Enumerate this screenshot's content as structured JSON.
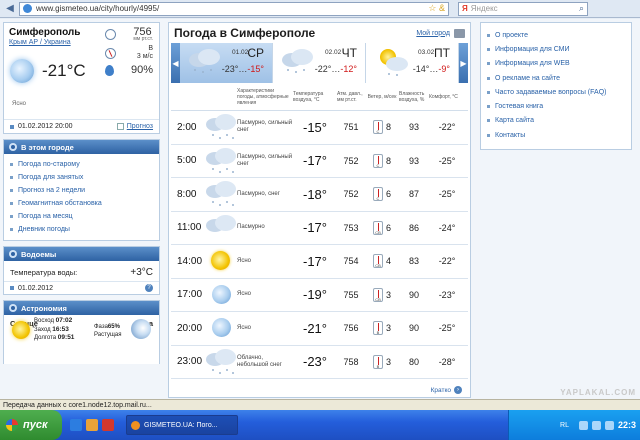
{
  "browser": {
    "url": "www.gismeteo.ua/city/hourly/4995/",
    "search_placeholder": "Яндекс",
    "search_logo": "Я"
  },
  "current": {
    "city": "Симферополь",
    "region": "Крым АР / Украина",
    "temp": "-21°C",
    "pressure": "756",
    "pressure_unit": "мм рт.ст.",
    "wind_dir": "В",
    "wind_speed": "3 м/с",
    "humidity": "90%",
    "desc": "Ясно",
    "date": "01.02.2012 20:00",
    "forecast_link": "Прогноз"
  },
  "city_menu": {
    "title": "В этом городе",
    "items": [
      {
        "label": "Погода по-старому"
      },
      {
        "label": "Погода для занятых"
      },
      {
        "label": "Прогноз на 2 недели"
      },
      {
        "label": "Геомагнитная обстановка"
      },
      {
        "label": "Погода на месяц"
      },
      {
        "label": "Дневник погоды"
      }
    ]
  },
  "water": {
    "title": "Водоемы",
    "label": "Температура воды:",
    "value": "+3°C",
    "date": "01.02.2012"
  },
  "astro": {
    "title": "Астрономия",
    "sun_label": "Солнце",
    "moon_label": "Луна",
    "rise_label": "Восход",
    "rise": "07:02",
    "set_label": "Заход",
    "set": "16:53",
    "duration_label": "Долгота",
    "duration": "09:51",
    "phase_label": "Фаза",
    "phase": "65%",
    "phase_state": "Растущая"
  },
  "center": {
    "title": "Погода в Симферополе",
    "my_city": "Мой город",
    "days": [
      {
        "date": "01.02",
        "weekday": "СР",
        "min": "-23°",
        "max": "-15°"
      },
      {
        "date": "02.02",
        "weekday": "ЧТ",
        "min": "-22°",
        "max": "-12°"
      },
      {
        "date": "03.02",
        "weekday": "ПТ",
        "min": "-14°",
        "max": "-9°"
      }
    ],
    "headers": {
      "desc": "Характеристики погоды, атмосферные явления",
      "temp": "Температура воздуха, °C",
      "press": "Атм. давл., мм рт.ст.",
      "wind": "Ветер, м/сек",
      "humid": "Влажность воздуха, %",
      "comfort": "Комфорт, °C"
    },
    "rows": [
      {
        "time": "2:00",
        "icon": "cloud-snow-icon",
        "desc": "Пасмурно, сильный снег",
        "temp": "-15°",
        "press": "751",
        "wind_dir": "С",
        "wind": "8",
        "humid": "93",
        "comfort": "-22°"
      },
      {
        "time": "5:00",
        "icon": "cloud-snow-icon",
        "desc": "Пасмурно, сильный снег",
        "temp": "-17°",
        "press": "752",
        "wind_dir": "С",
        "wind": "8",
        "humid": "93",
        "comfort": "-25°"
      },
      {
        "time": "8:00",
        "icon": "cloud-snow-icon",
        "desc": "Пасмурно, снег",
        "temp": "-18°",
        "press": "752",
        "wind_dir": "С",
        "wind": "6",
        "humid": "87",
        "comfort": "-25°"
      },
      {
        "time": "11:00",
        "icon": "cloud-icon",
        "desc": "Пасмурно",
        "temp": "-17°",
        "press": "753",
        "wind_dir": "СВ",
        "wind": "6",
        "humid": "86",
        "comfort": "-24°"
      },
      {
        "time": "14:00",
        "icon": "sun-icon",
        "desc": "Ясно",
        "temp": "-17°",
        "press": "754",
        "wind_dir": "СВ",
        "wind": "4",
        "humid": "83",
        "comfort": "-22°"
      },
      {
        "time": "17:00",
        "icon": "moon-icon",
        "desc": "Ясно",
        "temp": "-19°",
        "press": "755",
        "wind_dir": "СВ",
        "wind": "3",
        "humid": "90",
        "comfort": "-23°"
      },
      {
        "time": "20:00",
        "icon": "moon-icon",
        "desc": "Ясно",
        "temp": "-21°",
        "press": "756",
        "wind_dir": "В",
        "wind": "3",
        "humid": "90",
        "comfort": "-25°"
      },
      {
        "time": "23:00",
        "icon": "cloud-snow-icon",
        "desc": "Облачно, небольшой снег",
        "temp": "-23°",
        "press": "758",
        "wind_dir": "В",
        "wind": "3",
        "humid": "80",
        "comfort": "-28°"
      }
    ],
    "footer_link": "Кратко"
  },
  "right_menu": {
    "items": [
      {
        "label": "О проекте"
      },
      {
        "label": "Информация для СМИ"
      },
      {
        "label": "Информация для WEB"
      },
      {
        "label": "О рекламе на сайте"
      },
      {
        "label": "Часто задаваемые вопросы (FAQ)"
      },
      {
        "label": "Гостевая книга"
      },
      {
        "label": "Карта сайта"
      },
      {
        "label": "Контакты"
      }
    ]
  },
  "status": {
    "text": "Передача данных с core1.node12.top.mail.ru..."
  },
  "taskbar": {
    "start": "пуск",
    "task": "GISMETEO.UA: Пого...",
    "lang": "RL",
    "time": "22:3"
  },
  "watermark": "YAPLAKAL.COM"
}
